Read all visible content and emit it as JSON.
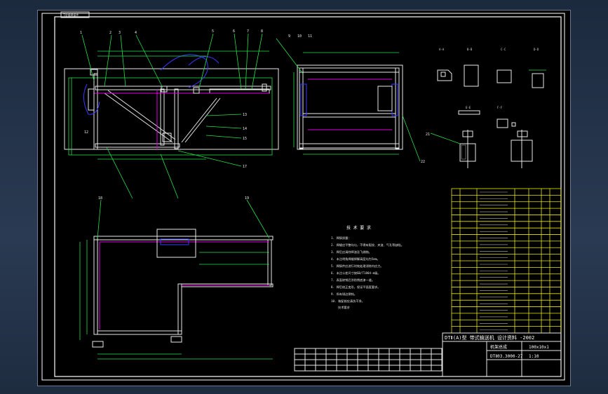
{
  "colors": {
    "background": "#000000",
    "frame": "#ffffff",
    "dimension": "#25e04a",
    "centerline": "#e000e0",
    "hidden": "#3a3aff",
    "table": "#e8e800"
  },
  "drawing": {
    "top_tag": "T形钢焊接件",
    "section_labels": [
      "A-A",
      "B-B",
      "C-C",
      "D-D",
      "E-E",
      "F-F"
    ],
    "notes_title": "技 术 要 求",
    "notes": [
      "1. 焊接质量：",
      "2. 焊缝应平整均匀，不得有裂纹、夹渣、气孔等缺陷。",
      "3. 焊后应清除焊渣及飞溅物。",
      "4. 未注明角焊缝焊脚高度均为5mm。",
      "5. 焊接件应进行时效处理消除内应力。",
      "6. 未注公差尺寸按GB/T1804-m级。",
      "7. 表面除锈后涂防锈底漆一道。",
      "8. 焊后校正变形，保证平面度要求。",
      "9. 所有锐边倒钝。",
      "10. 装配前应清洗干净。"
    ],
    "notes_footer": "技术要求",
    "company_line": "DTⅡ(A)型 带式输送机 设计资料 -2002",
    "drawing_no": "DTⅡ03.3000-27",
    "part_name": "机架总成",
    "scale": "1:10",
    "sheet": "100x10x1"
  }
}
